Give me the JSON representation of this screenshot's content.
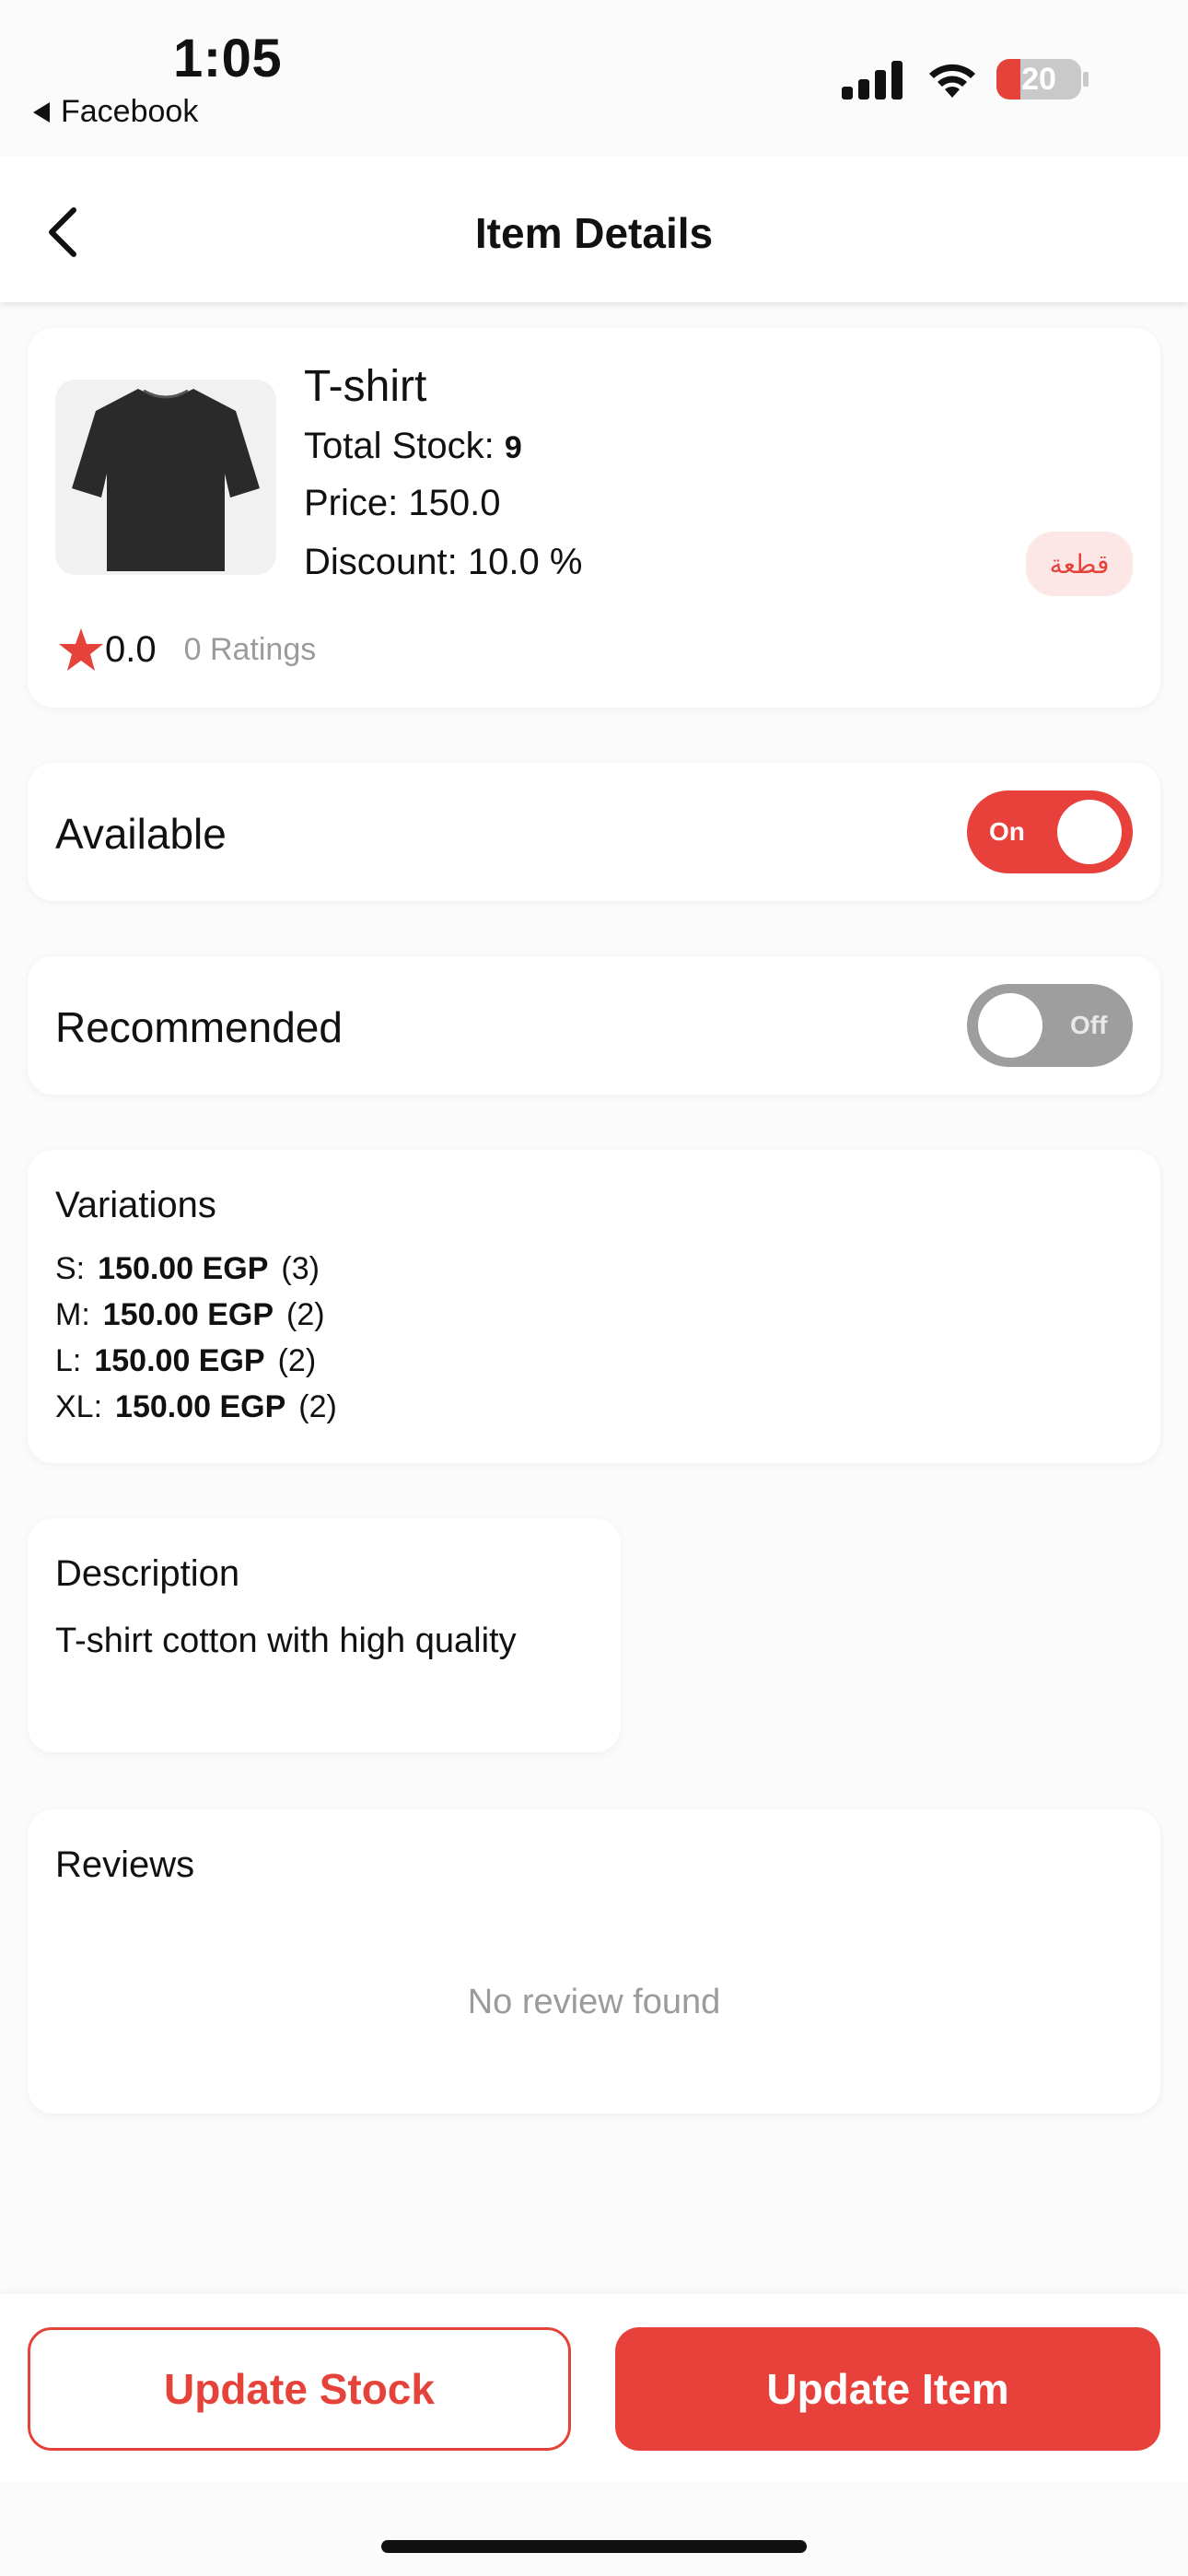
{
  "status": {
    "time": "1:05",
    "back_app": "Facebook",
    "battery": "20"
  },
  "header": {
    "title": "Item Details"
  },
  "product": {
    "name": "T-shirt",
    "stock_label": "Total Stock:",
    "stock_value": "9",
    "price": "Price: 150.0",
    "discount": "Discount: 10.0 %",
    "unit_badge": "قطعة",
    "rating_value": "0.0",
    "rating_count": "0 Ratings",
    "image_icon": "tshirt-image"
  },
  "available": {
    "label": "Available",
    "toggle": "On",
    "color": "#e8403a"
  },
  "recommended": {
    "label": "Recommended",
    "toggle": "Off",
    "color": "#9e9e9e"
  },
  "variations": {
    "title": "Variations",
    "items": [
      {
        "size": "S:",
        "price": "150.00 EGP",
        "qty": "(3)"
      },
      {
        "size": "M:",
        "price": "150.00 EGP",
        "qty": "(2)"
      },
      {
        "size": "L:",
        "price": "150.00 EGP",
        "qty": "(2)"
      },
      {
        "size": "XL:",
        "price": "150.00 EGP",
        "qty": "(2)"
      }
    ]
  },
  "description": {
    "title": "Description",
    "text": "T-shirt cotton with high quality"
  },
  "reviews": {
    "title": "Reviews",
    "empty": "No review found"
  },
  "actions": {
    "update_stock": "Update Stock",
    "update_item": "Update Item"
  },
  "colors": {
    "accent": "#e8403a",
    "badge_bg": "#fde7e6"
  }
}
